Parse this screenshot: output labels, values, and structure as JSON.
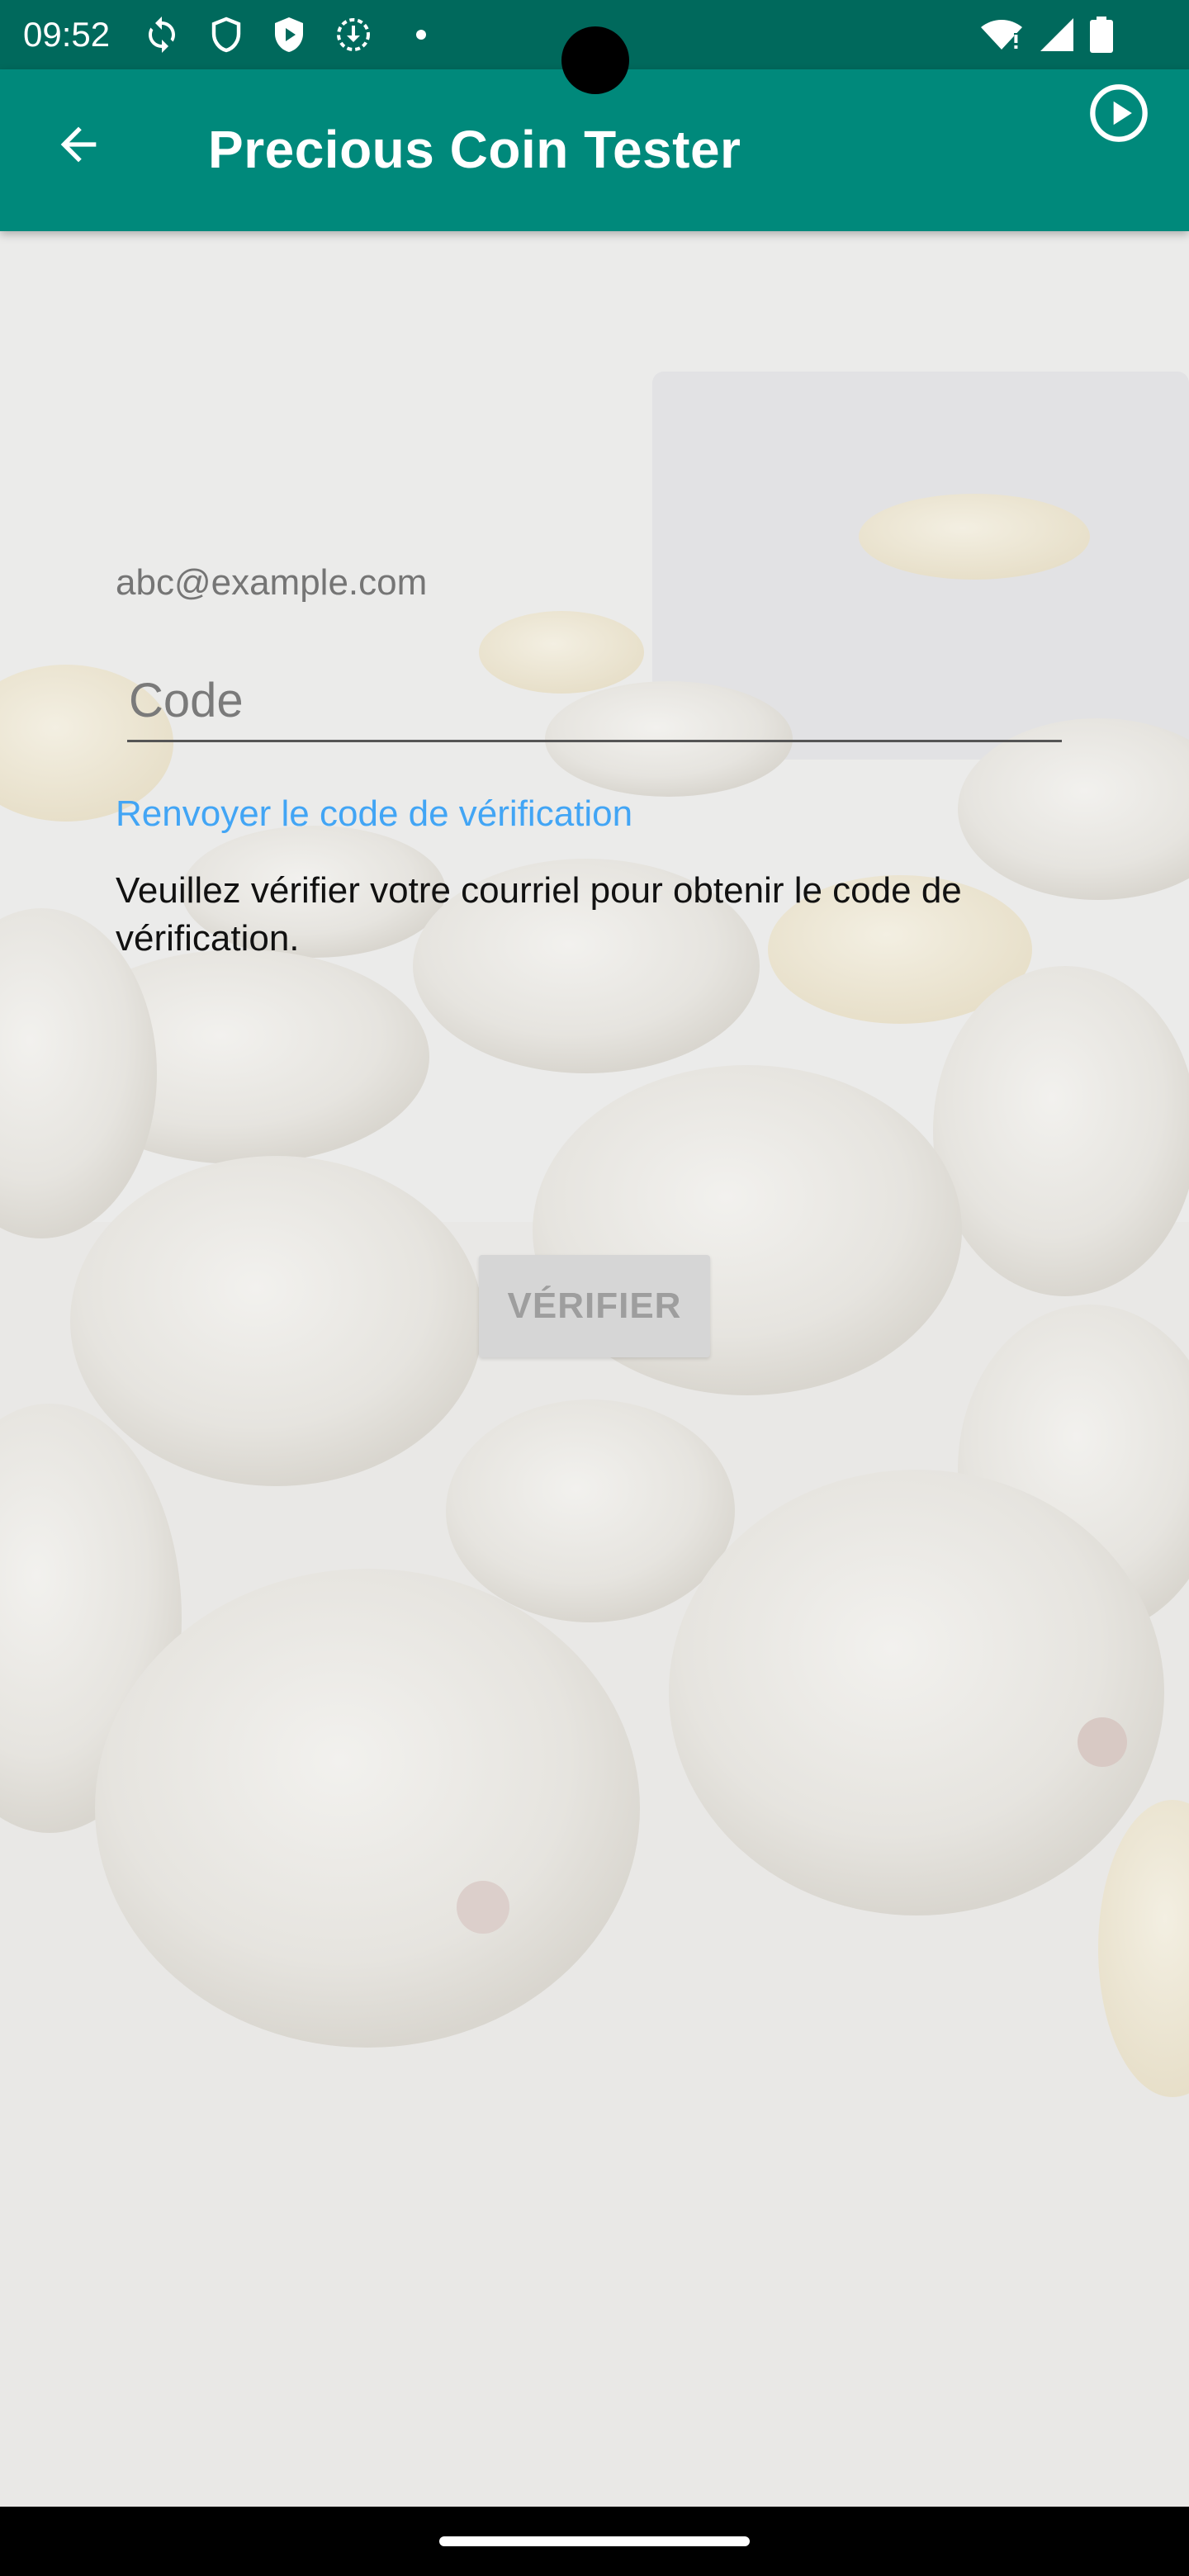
{
  "status_bar": {
    "time": "09:52",
    "left_icons": [
      "sync-icon",
      "shield-icon",
      "play-protect-icon",
      "download-icon",
      "dot-icon"
    ],
    "right_icons": [
      "wifi-icon",
      "signal-icon",
      "battery-icon"
    ]
  },
  "app_bar": {
    "title": "Precious Coin Tester",
    "back_icon": "arrow-back-icon",
    "action_icon": "play-circle-icon",
    "color": "#00897b",
    "status_color": "#00695c"
  },
  "form": {
    "email": "abc@example.com",
    "code_placeholder": "Code",
    "code_value": "",
    "resend_link": "Renvoyer le code de vérification",
    "instructions": "Veuillez vérifier votre courriel pour obtenir le code de vérification.",
    "verify_button": "VÉRIFIER",
    "link_color": "#42a5f5"
  }
}
